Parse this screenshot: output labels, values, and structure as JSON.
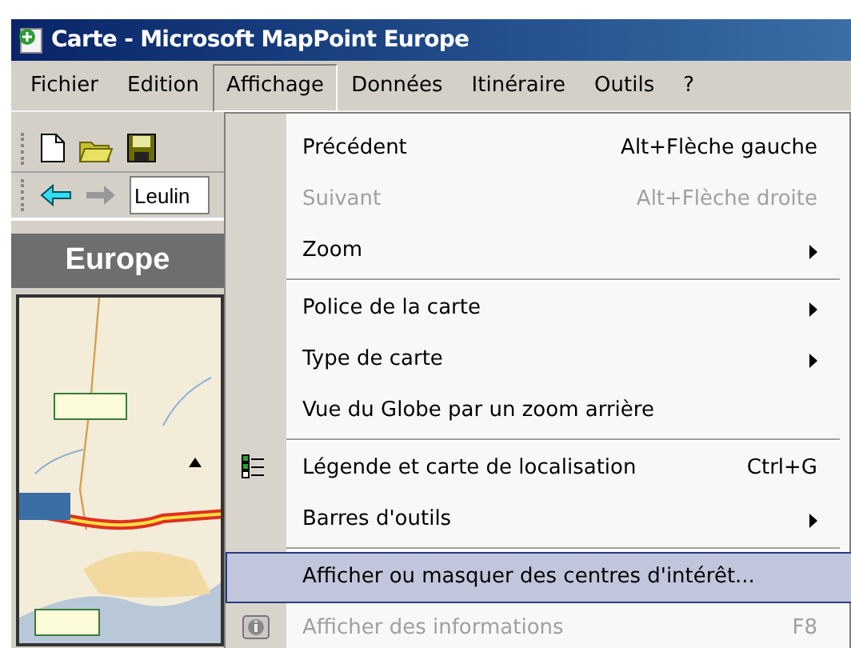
{
  "window": {
    "title": "Carte - Microsoft MapPoint Europe"
  },
  "menubar": [
    {
      "label": "Fichier",
      "selected": false
    },
    {
      "label": "Edition",
      "selected": false
    },
    {
      "label": "Affichage",
      "selected": true
    },
    {
      "label": "Données",
      "selected": false
    },
    {
      "label": "Itinéraire",
      "selected": false
    },
    {
      "label": "Outils",
      "selected": false
    },
    {
      "label": "?",
      "selected": false
    }
  ],
  "navigation": {
    "value": "Leulin"
  },
  "panel": {
    "title": "Europe"
  },
  "menu": [
    {
      "label": "Précédent",
      "shortcut": "Alt+Flèche gauche",
      "disabled": false,
      "submenu": false,
      "selected": false,
      "separator_after": false
    },
    {
      "label": "Suivant",
      "shortcut": "Alt+Flèche droite",
      "disabled": true,
      "submenu": false,
      "selected": false,
      "separator_after": false
    },
    {
      "label": "Zoom",
      "disabled": false,
      "submenu": true,
      "selected": false,
      "separator_after": true
    },
    {
      "label": "Police de la carte",
      "disabled": false,
      "submenu": true,
      "selected": false,
      "separator_after": false
    },
    {
      "label": "Type de carte",
      "disabled": false,
      "submenu": true,
      "selected": false,
      "separator_after": false
    },
    {
      "label": "Vue du Globe par un zoom arrière",
      "disabled": false,
      "submenu": false,
      "selected": false,
      "separator_after": true
    },
    {
      "label": "Légende et carte de localisation",
      "shortcut": "Ctrl+G",
      "disabled": false,
      "submenu": false,
      "selected": false,
      "separator_after": false,
      "kind": "legend"
    },
    {
      "label": "Barres d'outils",
      "disabled": false,
      "submenu": true,
      "selected": false,
      "separator_after": true
    },
    {
      "label": "Afficher ou masquer des centres d'intérêt...",
      "disabled": false,
      "submenu": false,
      "selected": true,
      "separator_after": false
    },
    {
      "label": "Afficher des informations",
      "shortcut": "F8",
      "disabled": true,
      "submenu": false,
      "selected": false,
      "separator_after": false,
      "kind": "info"
    }
  ]
}
